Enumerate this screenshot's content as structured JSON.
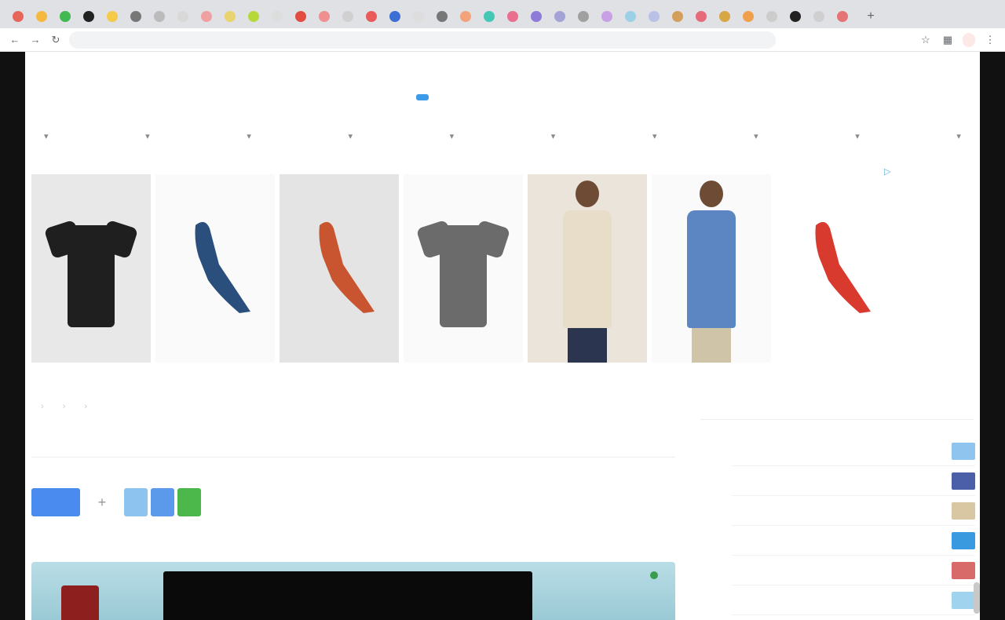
{
  "browser": {
    "tabs": [
      {
        "color": "#e6665c"
      },
      {
        "color": "#f5b940"
      },
      {
        "color": "#3fb950"
      },
      {
        "color": "#222222"
      },
      {
        "color": "#f7c948"
      },
      {
        "color": "#777777"
      },
      {
        "color": "#bbbbbb"
      },
      {
        "color": "#d8d8d8"
      },
      {
        "color": "#f0a0a0"
      },
      {
        "color": "#e9d36e"
      },
      {
        "color": "#b7d83a"
      },
      {
        "color": "#dddddd"
      },
      {
        "color": "#e14d3f"
      },
      {
        "color": "#ef8f8f"
      },
      {
        "color": "#d0d0d0"
      },
      {
        "color": "#e95b5b"
      },
      {
        "color": "#3b6fd6"
      },
      {
        "color": "#dddddd"
      },
      {
        "color": "#777777"
      },
      {
        "color": "#f2a37a"
      },
      {
        "color": "#46c7b5"
      },
      {
        "color": "#ea6f8e"
      },
      {
        "color": "#8e7ad8"
      },
      {
        "color": "#a3a3d6"
      },
      {
        "color": "#a0a0a0"
      },
      {
        "color": "#c9a0e6"
      },
      {
        "color": "#9bd0e6"
      },
      {
        "color": "#b9c1e6"
      },
      {
        "color": "#d69e5b"
      },
      {
        "color": "#e66a7a"
      },
      {
        "color": "#d7a743"
      },
      {
        "color": "#f0a04a"
      },
      {
        "color": "#cccccc"
      },
      {
        "color": "#222222"
      },
      {
        "color": "#cfcfcf"
      },
      {
        "color": "#e57373"
      }
    ],
    "new_tab_glyph": "+",
    "url": "",
    "profile_label": ""
  },
  "site": {
    "logo_text": "",
    "logo_badge": "",
    "nav": [
      "",
      "",
      "",
      "",
      "",
      "",
      "",
      "",
      "",
      ""
    ]
  },
  "ad": {
    "items": [
      {
        "kind": "shirt",
        "bg": "#e8e8e8",
        "color": "#1f1f1f"
      },
      {
        "kind": "bird",
        "bg": "#fafafa",
        "color": "#2b4f7c"
      },
      {
        "kind": "bird",
        "bg": "#e4e4e4",
        "color": "#c8552f"
      },
      {
        "kind": "shirt",
        "bg": "#fafafa",
        "color": "#6b6b6b"
      },
      {
        "kind": "person",
        "bg": "#ebe4da",
        "color": "#e8ddc9"
      },
      {
        "kind": "person",
        "bg": "#fafafa",
        "color": "#5c86c2"
      },
      {
        "kind": "bird",
        "bg": "#ffffff",
        "color": "#d83a2e"
      }
    ]
  },
  "article": {
    "breadcrumbs": [
      "",
      "",
      "",
      ""
    ],
    "title": "",
    "share_plus": "+",
    "share_colors": [
      "#8cc3ef",
      "#5b9aea",
      "#4cb84c"
    ],
    "byline": [
      "",
      ""
    ]
  },
  "sidebar": {
    "title": "",
    "items": [
      {
        "label": "",
        "thumb": "#8ec4ee"
      },
      {
        "label": "",
        "thumb": "#4a5fa8"
      },
      {
        "label": "",
        "thumb": "#d9c7a3"
      },
      {
        "label": "",
        "thumb": "#3a9ae0"
      },
      {
        "label": "",
        "thumb": "#d96a6a"
      },
      {
        "label": "",
        "thumb": "#9fd3ee"
      }
    ]
  }
}
